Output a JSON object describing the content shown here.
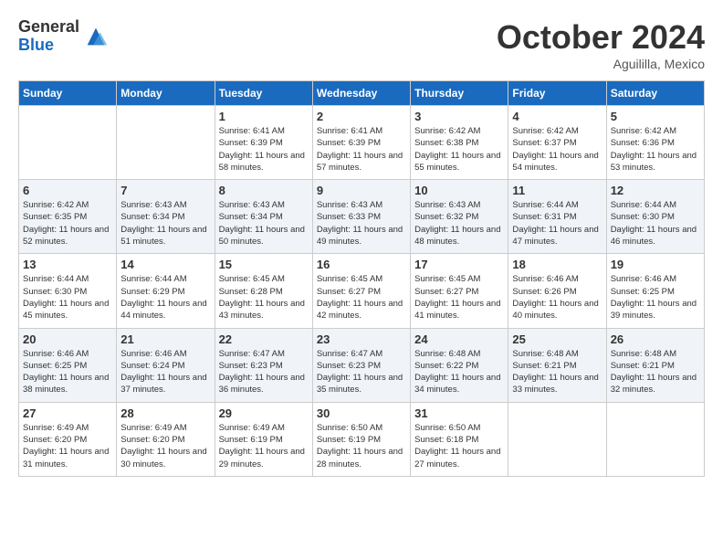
{
  "header": {
    "logo_general": "General",
    "logo_blue": "Blue",
    "month_title": "October 2024",
    "location": "Aguililla, Mexico"
  },
  "days_of_week": [
    "Sunday",
    "Monday",
    "Tuesday",
    "Wednesday",
    "Thursday",
    "Friday",
    "Saturday"
  ],
  "weeks": [
    [
      {
        "day": "",
        "sunrise": "",
        "sunset": "",
        "daylight": ""
      },
      {
        "day": "",
        "sunrise": "",
        "sunset": "",
        "daylight": ""
      },
      {
        "day": "1",
        "sunrise": "Sunrise: 6:41 AM",
        "sunset": "Sunset: 6:39 PM",
        "daylight": "Daylight: 11 hours and 58 minutes."
      },
      {
        "day": "2",
        "sunrise": "Sunrise: 6:41 AM",
        "sunset": "Sunset: 6:39 PM",
        "daylight": "Daylight: 11 hours and 57 minutes."
      },
      {
        "day": "3",
        "sunrise": "Sunrise: 6:42 AM",
        "sunset": "Sunset: 6:38 PM",
        "daylight": "Daylight: 11 hours and 55 minutes."
      },
      {
        "day": "4",
        "sunrise": "Sunrise: 6:42 AM",
        "sunset": "Sunset: 6:37 PM",
        "daylight": "Daylight: 11 hours and 54 minutes."
      },
      {
        "day": "5",
        "sunrise": "Sunrise: 6:42 AM",
        "sunset": "Sunset: 6:36 PM",
        "daylight": "Daylight: 11 hours and 53 minutes."
      }
    ],
    [
      {
        "day": "6",
        "sunrise": "Sunrise: 6:42 AM",
        "sunset": "Sunset: 6:35 PM",
        "daylight": "Daylight: 11 hours and 52 minutes."
      },
      {
        "day": "7",
        "sunrise": "Sunrise: 6:43 AM",
        "sunset": "Sunset: 6:34 PM",
        "daylight": "Daylight: 11 hours and 51 minutes."
      },
      {
        "day": "8",
        "sunrise": "Sunrise: 6:43 AM",
        "sunset": "Sunset: 6:34 PM",
        "daylight": "Daylight: 11 hours and 50 minutes."
      },
      {
        "day": "9",
        "sunrise": "Sunrise: 6:43 AM",
        "sunset": "Sunset: 6:33 PM",
        "daylight": "Daylight: 11 hours and 49 minutes."
      },
      {
        "day": "10",
        "sunrise": "Sunrise: 6:43 AM",
        "sunset": "Sunset: 6:32 PM",
        "daylight": "Daylight: 11 hours and 48 minutes."
      },
      {
        "day": "11",
        "sunrise": "Sunrise: 6:44 AM",
        "sunset": "Sunset: 6:31 PM",
        "daylight": "Daylight: 11 hours and 47 minutes."
      },
      {
        "day": "12",
        "sunrise": "Sunrise: 6:44 AM",
        "sunset": "Sunset: 6:30 PM",
        "daylight": "Daylight: 11 hours and 46 minutes."
      }
    ],
    [
      {
        "day": "13",
        "sunrise": "Sunrise: 6:44 AM",
        "sunset": "Sunset: 6:30 PM",
        "daylight": "Daylight: 11 hours and 45 minutes."
      },
      {
        "day": "14",
        "sunrise": "Sunrise: 6:44 AM",
        "sunset": "Sunset: 6:29 PM",
        "daylight": "Daylight: 11 hours and 44 minutes."
      },
      {
        "day": "15",
        "sunrise": "Sunrise: 6:45 AM",
        "sunset": "Sunset: 6:28 PM",
        "daylight": "Daylight: 11 hours and 43 minutes."
      },
      {
        "day": "16",
        "sunrise": "Sunrise: 6:45 AM",
        "sunset": "Sunset: 6:27 PM",
        "daylight": "Daylight: 11 hours and 42 minutes."
      },
      {
        "day": "17",
        "sunrise": "Sunrise: 6:45 AM",
        "sunset": "Sunset: 6:27 PM",
        "daylight": "Daylight: 11 hours and 41 minutes."
      },
      {
        "day": "18",
        "sunrise": "Sunrise: 6:46 AM",
        "sunset": "Sunset: 6:26 PM",
        "daylight": "Daylight: 11 hours and 40 minutes."
      },
      {
        "day": "19",
        "sunrise": "Sunrise: 6:46 AM",
        "sunset": "Sunset: 6:25 PM",
        "daylight": "Daylight: 11 hours and 39 minutes."
      }
    ],
    [
      {
        "day": "20",
        "sunrise": "Sunrise: 6:46 AM",
        "sunset": "Sunset: 6:25 PM",
        "daylight": "Daylight: 11 hours and 38 minutes."
      },
      {
        "day": "21",
        "sunrise": "Sunrise: 6:46 AM",
        "sunset": "Sunset: 6:24 PM",
        "daylight": "Daylight: 11 hours and 37 minutes."
      },
      {
        "day": "22",
        "sunrise": "Sunrise: 6:47 AM",
        "sunset": "Sunset: 6:23 PM",
        "daylight": "Daylight: 11 hours and 36 minutes."
      },
      {
        "day": "23",
        "sunrise": "Sunrise: 6:47 AM",
        "sunset": "Sunset: 6:23 PM",
        "daylight": "Daylight: 11 hours and 35 minutes."
      },
      {
        "day": "24",
        "sunrise": "Sunrise: 6:48 AM",
        "sunset": "Sunset: 6:22 PM",
        "daylight": "Daylight: 11 hours and 34 minutes."
      },
      {
        "day": "25",
        "sunrise": "Sunrise: 6:48 AM",
        "sunset": "Sunset: 6:21 PM",
        "daylight": "Daylight: 11 hours and 33 minutes."
      },
      {
        "day": "26",
        "sunrise": "Sunrise: 6:48 AM",
        "sunset": "Sunset: 6:21 PM",
        "daylight": "Daylight: 11 hours and 32 minutes."
      }
    ],
    [
      {
        "day": "27",
        "sunrise": "Sunrise: 6:49 AM",
        "sunset": "Sunset: 6:20 PM",
        "daylight": "Daylight: 11 hours and 31 minutes."
      },
      {
        "day": "28",
        "sunrise": "Sunrise: 6:49 AM",
        "sunset": "Sunset: 6:20 PM",
        "daylight": "Daylight: 11 hours and 30 minutes."
      },
      {
        "day": "29",
        "sunrise": "Sunrise: 6:49 AM",
        "sunset": "Sunset: 6:19 PM",
        "daylight": "Daylight: 11 hours and 29 minutes."
      },
      {
        "day": "30",
        "sunrise": "Sunrise: 6:50 AM",
        "sunset": "Sunset: 6:19 PM",
        "daylight": "Daylight: 11 hours and 28 minutes."
      },
      {
        "day": "31",
        "sunrise": "Sunrise: 6:50 AM",
        "sunset": "Sunset: 6:18 PM",
        "daylight": "Daylight: 11 hours and 27 minutes."
      },
      {
        "day": "",
        "sunrise": "",
        "sunset": "",
        "daylight": ""
      },
      {
        "day": "",
        "sunrise": "",
        "sunset": "",
        "daylight": ""
      }
    ]
  ]
}
